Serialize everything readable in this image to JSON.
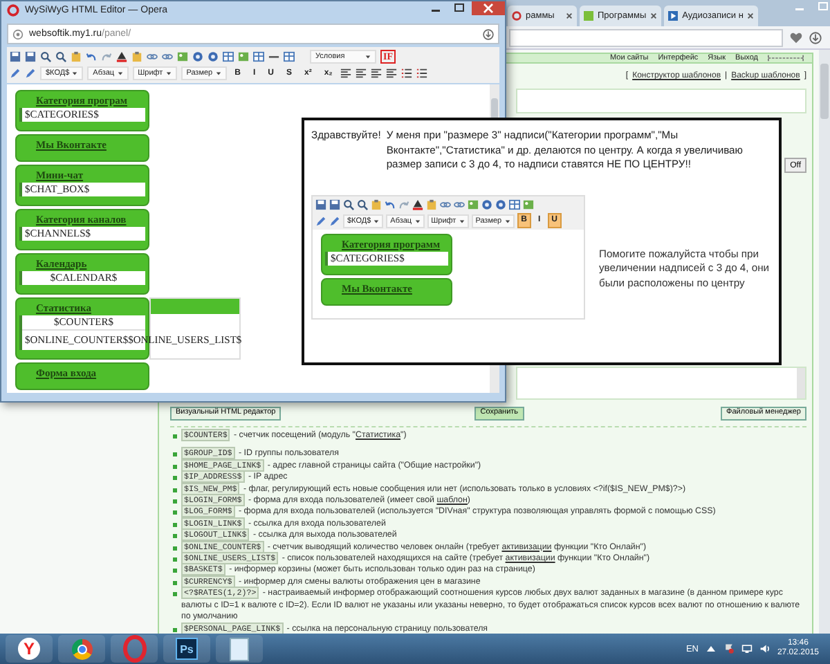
{
  "browser": {
    "tabs": [
      "раммы",
      "Программы",
      "Аудиозаписи н"
    ],
    "topbar": [
      "Мои сайты",
      "Интерфейс",
      "Язык",
      "Выход"
    ],
    "bracket_open": "[",
    "template_links": [
      "Конструктор шаблонов",
      "Backup шаблонов"
    ],
    "separator": "|",
    "bracket_close": "]",
    "off_button": "Off",
    "buttons": [
      "Визуальный HTML редактор",
      "Сохранить",
      "Файловый менеджер"
    ],
    "variables": [
      {
        "code": "$COUNTER$",
        "parts": [
          {
            "kind": "text",
            "text": " - счетчик посещений (модуль \""
          },
          {
            "kind": "link",
            "text": "Статистика"
          },
          {
            "kind": "text",
            "text": "\")"
          }
        ]
      },
      {
        "code": "$GROUP_ID$",
        "parts": [
          {
            "kind": "text",
            "text": " - ID группы пользователя"
          }
        ]
      },
      {
        "code": "$HOME_PAGE_LINK$",
        "parts": [
          {
            "kind": "text",
            "text": " - адрес главной страницы сайта (\"Общие настройки\")"
          }
        ]
      },
      {
        "code": "$IP_ADDRESS$",
        "parts": [
          {
            "kind": "text",
            "text": " - IP адрес"
          }
        ]
      },
      {
        "code": "$IS_NEW_PM$",
        "parts": [
          {
            "kind": "text",
            "text": " - флаг, регулирующий есть новые сообщения или нет (использовать только в условиях <?if($IS_NEW_PM$)?>)"
          }
        ]
      },
      {
        "code": "$LOGIN_FORM$",
        "parts": [
          {
            "kind": "text",
            "text": " - форма для входа пользователей (имеет свой "
          },
          {
            "kind": "link",
            "text": "шаблон"
          },
          {
            "kind": "text",
            "text": ")"
          }
        ]
      },
      {
        "code": "$LOG_FORM$",
        "parts": [
          {
            "kind": "text",
            "text": " - форма для входа пользователей (используется \"DIVная\" структура позволяющая управлять формой с помощью CSS)"
          }
        ]
      },
      {
        "code": "$LOGIN_LINK$",
        "parts": [
          {
            "kind": "text",
            "text": " - ссылка для входа пользователей"
          }
        ]
      },
      {
        "code": "$LOGOUT_LINK$",
        "parts": [
          {
            "kind": "text",
            "text": " - ссылка для выхода пользователей"
          }
        ]
      },
      {
        "code": "$ONLINE_COUNTER$",
        "parts": [
          {
            "kind": "text",
            "text": " - счетчик выводящий количество человек онлайн (требует "
          },
          {
            "kind": "link",
            "text": "активизации"
          },
          {
            "kind": "text",
            "text": " функции \"Кто Онлайн\")"
          }
        ]
      },
      {
        "code": "$ONLINE_USERS_LIST$",
        "parts": [
          {
            "kind": "text",
            "text": " - список пользователей находящихся на сайте (требует "
          },
          {
            "kind": "link",
            "text": "активизации"
          },
          {
            "kind": "text",
            "text": " функции \"Кто Онлайн\")"
          }
        ]
      },
      {
        "code": "$BASKET$",
        "parts": [
          {
            "kind": "text",
            "text": " - информер корзины (может быть использован только один раз на странице)"
          }
        ]
      },
      {
        "code": "$CURRENCY$",
        "parts": [
          {
            "kind": "text",
            "text": " - информер для смены валюты отображения цен в магазине"
          }
        ]
      },
      {
        "code": "<?$RATES(1,2)?>",
        "parts": [
          {
            "kind": "text",
            "text": " - настраиваемый информер отображающий соотношения курсов любых двух валют заданных в магазине (в данном примере курс валюты с ID=1 к валюте с ID=2). Если ID валют не указаны или указаны неверно, то будет отображаться список курсов всех валют по отношению к валюте по умолчанию"
          }
        ]
      },
      {
        "code": "$PERSONAL_PAGE_LINK$",
        "parts": [
          {
            "kind": "text",
            "text": " - ссылка на персональную страницу пользователя"
          }
        ]
      }
    ]
  },
  "editor": {
    "title": "WySiWyG HTML Editor — Opera",
    "url_host": "websoftik.my1.ru",
    "url_path": "/panel/",
    "conditions_select": "Условия",
    "if_button": "IF",
    "selects": [
      "$КОД$",
      "Абзац",
      "Шрифт",
      "Размер"
    ],
    "format_buttons": [
      {
        "label": "B",
        "active": false
      },
      {
        "label": "I",
        "active": false
      },
      {
        "label": "U",
        "active": false
      },
      {
        "label": "S",
        "active": false
      },
      {
        "label": "x²",
        "active": false
      },
      {
        "label": "x₂",
        "active": false
      }
    ],
    "blocks": [
      {
        "title": "Категория програм",
        "lines": [
          {
            "text": "$CATEGORIES$",
            "centered": false
          }
        ]
      },
      {
        "title": "Мы Вконтакте"
      },
      {
        "title": "Мини-чат",
        "lines": [
          {
            "text": "$CHAT_BOX$",
            "centered": false
          }
        ]
      },
      {
        "title": "Категория каналов",
        "lines": [
          {
            "text": "$CHANNELS$",
            "centered": false
          }
        ]
      },
      {
        "title": "Календарь",
        "lines": [
          {
            "text": "$CALENDAR$",
            "centered": true
          }
        ]
      },
      {
        "title": "Статистика",
        "side_panel": true,
        "lines": [
          {
            "text": "$COUNTER$",
            "centered": true
          },
          {
            "text": "$ONLINE_COUNTER$$ONLINE_USERS_LIST$",
            "centered": false
          }
        ]
      },
      {
        "title": "Форма входа"
      }
    ]
  },
  "annotation": {
    "greeting": "Здравствуйте!",
    "message": "У меня при \"размере 3\" надписи(\"Категории программ\",\"Мы Вконтакте\",\"Статистика\" и др. делаются по центру. А когда я увеличиваю размер записи с 3 до 4, то надписи ставятся НЕ ПО ЦЕНТРУ!!",
    "request": "Помогите пожалуйста чтобы при увеличении надписей с 3 до 4, они были расположены по центру",
    "inset": {
      "selects": [
        "$КОД$",
        "Абзац",
        "Шрифт",
        "Размер"
      ],
      "format_buttons": [
        {
          "label": "B",
          "active": true
        },
        {
          "label": "I",
          "active": false
        },
        {
          "label": "U",
          "active": true
        }
      ],
      "blocks": [
        {
          "title": "Категория программ",
          "lines": [
            {
              "text": "$CATEGORIES$",
              "centered": false
            }
          ]
        },
        {
          "title": "Мы Вконтакте"
        }
      ]
    }
  },
  "taskbar": {
    "apps": [
      {
        "kind": "yandex",
        "label": "Y"
      },
      {
        "kind": "chrome"
      },
      {
        "kind": "opera"
      },
      {
        "kind": "photoshop",
        "label": "Ps"
      },
      {
        "kind": "notepad"
      }
    ],
    "language": "EN",
    "time": "13:46",
    "date": "27.02.2015"
  }
}
